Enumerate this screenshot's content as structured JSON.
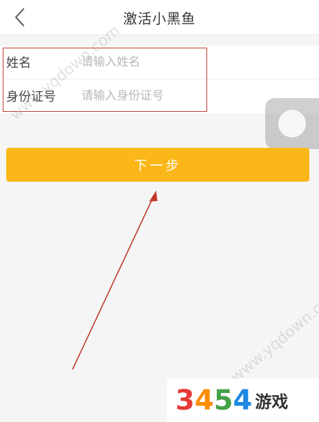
{
  "header": {
    "title": "激活小黑鱼"
  },
  "form": {
    "name_label": "姓名",
    "name_placeholder": "请输入姓名",
    "id_label": "身份证号",
    "id_placeholder": "请输入身份证号"
  },
  "actions": {
    "next_label": "下一步"
  },
  "watermark": {
    "text": "www.yqdown.com"
  },
  "logo": {
    "digits": [
      "3",
      "4",
      "5",
      "4"
    ],
    "text": "游戏"
  },
  "colors": {
    "accent": "#fbb718",
    "annotation": "#c0392b"
  },
  "icons": {
    "back": "chevron-left-icon",
    "float": "assistive-touch-icon"
  }
}
